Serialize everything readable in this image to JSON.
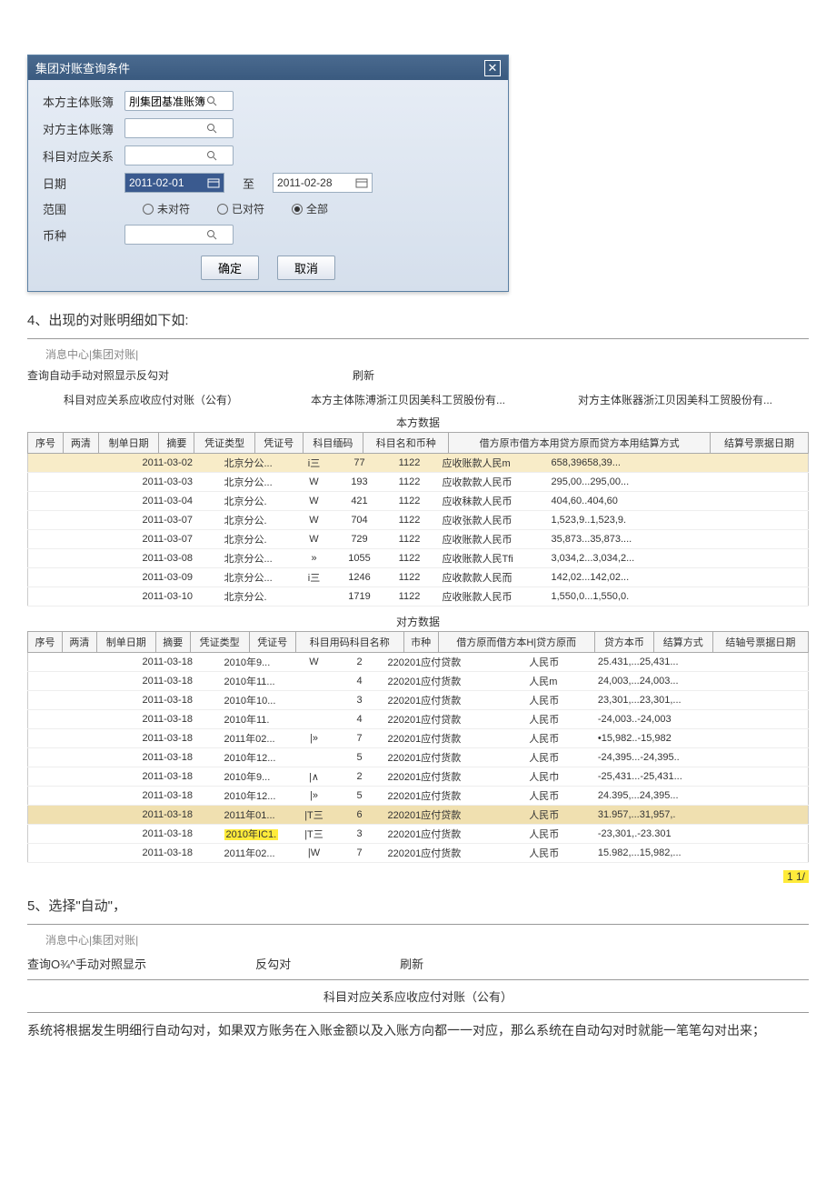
{
  "dialog": {
    "title": "集团对账查询条件",
    "labels": {
      "own_ledger": "本方主体账簿",
      "other_ledger": "对方主体账簿",
      "subject_rel": "科目对应关系",
      "date": "日期",
      "range": "范围",
      "currency": "币种"
    },
    "own_ledger_value": "刖集团基准账簿",
    "date_from": "2011-02-01",
    "date_to_label": "至",
    "date_to": "2011-02-28",
    "range_options": {
      "unmatched": "未对符",
      "matched": "已对符",
      "all": "全部"
    },
    "range_selected": "all",
    "ok": "确定",
    "cancel": "取消"
  },
  "step4_text": "4、出现的对账明细如下如:",
  "tabs1": "消息中心|集团对账|",
  "toolbar1": {
    "items": "查询自动手动对照显示反勾对",
    "refresh": "刷新"
  },
  "info_row": {
    "subject_rel": "科目对应关系应收应付对账（公有）",
    "own_entity": "本方主体陈溥浙江贝因美科工贸股份有...",
    "other_entity": "对方主体账器浙江贝因美科工贸股份有..."
  },
  "own_data_title": "本方数据",
  "own_headers": [
    "序号",
    "两清",
    "制单日期",
    "摘要",
    "凭证类型",
    "凭证号",
    "科目缅码",
    "科目名和币种",
    "借方原市借方本用贷方原而贷方本用结算方式",
    "结算号票据日期"
  ],
  "own_rows": [
    {
      "hl": true,
      "date": "2011-03-02",
      "summ": "北京分公...",
      "vt": "i三",
      "vn": "77",
      "code": "1122",
      "name": "应收账款人民m",
      "amt": "658,39658,39..."
    },
    {
      "date": "2011-03-03",
      "summ": "北京分公...",
      "vt": "W",
      "vn": "193",
      "code": "1122",
      "name": "应收款款人民币",
      "amt": "295,00...295,00..."
    },
    {
      "date": "2011-03-04",
      "summ": "北京分公.",
      "vt": "W",
      "vn": "421",
      "code": "1122",
      "name": "应收秣款人民币",
      "amt": "404,60..404,60"
    },
    {
      "date": "2011-03-07",
      "summ": "北京分公.",
      "vt": "W",
      "vn": "704",
      "code": "1122",
      "name": "应收张款人民币",
      "amt": "1,523,9..1,523,9."
    },
    {
      "date": "2011-03-07",
      "summ": "北京分公.",
      "vt": "W",
      "vn": "729",
      "code": "1122",
      "name": "应收账款人民币",
      "amt": "35,873...35,873...."
    },
    {
      "date": "2011-03-08",
      "summ": "北京分公...",
      "vt": "»",
      "vn": "1055",
      "code": "1122",
      "name": "应收账款人民Tfi",
      "amt": "3,034,2...3,034,2..."
    },
    {
      "date": "2011-03-09",
      "summ": "北京分公...",
      "vt": "i三",
      "vn": "1246",
      "code": "1122",
      "name": "应收款款人民而",
      "amt": "142,02...142,02..."
    },
    {
      "date": "2011-03-10",
      "summ": "北京分公.",
      "vt": "",
      "vn": "1719",
      "code": "1122",
      "name": "应收账款人民币",
      "amt": "1,550,0...1,550,0."
    }
  ],
  "other_data_title": "对方数据",
  "other_headers": [
    "序号",
    "两清",
    "制单日期",
    "摘要",
    "凭证类型",
    "凭证号",
    "科目用码科目名称",
    "市种",
    "借方原而借方本H|贷方原而",
    "贷方本币",
    "结算方式",
    "结轴号票据日期"
  ],
  "other_rows": [
    {
      "date": "2011-03-18",
      "summ": "2010年9...",
      "vt": "W",
      "vn": "2",
      "codename": "220201应付贷款",
      "cur": "人民币",
      "amt": "25.431,...25,431..."
    },
    {
      "date": "2011-03-18",
      "summ": "2010年11...",
      "vt": "",
      "vn": "4",
      "codename": "220201应付货款",
      "cur": "人民m",
      "amt": "24,003,...24,003..."
    },
    {
      "date": "2011-03-18",
      "summ": "2010年10...",
      "vt": "",
      "vn": "3",
      "codename": "220201应付货款",
      "cur": "人民币",
      "amt": "23,301,...23,301,..."
    },
    {
      "date": "2011-03-18",
      "summ": "2010年11.",
      "vt": "",
      "vn": "4",
      "codename": "220201应付贷款",
      "cur": "人民币",
      "amt": "-24,003..-24,003"
    },
    {
      "date": "2011-03-18",
      "summ": "2011年02...",
      "vt": "|»",
      "vn": "7",
      "codename": "220201应付货款",
      "cur": "人民币",
      "amt": "•15,982..-15,982"
    },
    {
      "date": "2011-03-18",
      "summ": "2010年12...",
      "vt": "",
      "vn": "5",
      "codename": "220201应付货款",
      "cur": "人民币",
      "amt": "-24,395...-24,395.."
    },
    {
      "date": "2011-03-18",
      "summ": "2010年9...",
      "vt": "|∧",
      "vn": "2",
      "codename": "220201应付货款",
      "cur": "人民巾",
      "amt": "-25,431...-25,431..."
    },
    {
      "date": "2011-03-18",
      "summ": "2010年12...",
      "vt": "|»",
      "vn": "5",
      "codename": "220201应付货款",
      "cur": "人民币",
      "amt": "24.395,...24,395..."
    },
    {
      "hl": true,
      "date": "2011-03-18",
      "summ": "2011年01...",
      "vt": "|T三",
      "vn": "6",
      "codename": "220201应付贷款",
      "cur": "人民币",
      "amt": "31.957,...31,957,."
    },
    {
      "date": "2011-03-18",
      "summ": "2010年IC1.",
      "vt": "|T三",
      "vn": "3",
      "codename": "220201应付货款",
      "cur": "人民币",
      "amt": "-23,301,.-23.301",
      "summ_hl": true
    },
    {
      "date": "2011-03-18",
      "summ": "2011年02...",
      "vt": "|W",
      "vn": "7",
      "codename": "220201应付货款",
      "cur": "人民币",
      "amt": "15.982,...15,982,..."
    }
  ],
  "page_marker": "1 1/",
  "step5_text": "5、选择\"自动\"，",
  "tabs2": "消息中心|集团对账|",
  "toolbar2": {
    "a": "查询O¾^手动对照显示",
    "b": "反勾对",
    "c": "刷新"
  },
  "subject_rel2": "科目对应关系应收应付对账（公有）",
  "body_text": "系统将根据发生明细行自动勾对，如果双方账务在入账金额以及入账方向都一一对应，那么系统在自动勾对时就能一笔笔勾对出来；"
}
